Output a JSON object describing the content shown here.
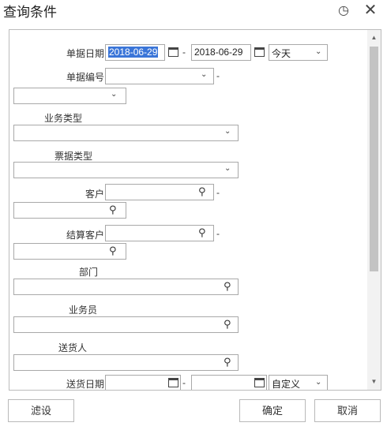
{
  "dialog": {
    "title": "查询条件",
    "help_icon": "?",
    "close_icon": "✕"
  },
  "form": {
    "doc_date": {
      "label": "单据日期",
      "from": "2018-06-29",
      "to": "2018-06-29",
      "period": "今天"
    },
    "doc_no": {
      "label": "单据编号",
      "value": "",
      "value2": ""
    },
    "biz_type": {
      "label": "业务类型",
      "value": ""
    },
    "bill_type": {
      "label": "票据类型",
      "value": ""
    },
    "customer": {
      "label": "客户",
      "from": "",
      "to": ""
    },
    "settle_customer": {
      "label": "结算客户",
      "from": "",
      "to": ""
    },
    "department": {
      "label": "部门",
      "value": ""
    },
    "salesman": {
      "label": "业务员",
      "value": ""
    },
    "deliverer": {
      "label": "送货人",
      "value": ""
    },
    "delivery_date": {
      "label": "送货日期",
      "from": "",
      "to": "",
      "period": "自定义"
    }
  },
  "separator": "-",
  "footer": {
    "filter_label": "滤设",
    "ok_label": "确定",
    "cancel_label": "取消"
  },
  "colors": {
    "selection": "#3a75d8",
    "border": "#a9a9a9",
    "scroll_thumb": "#c3c3c3"
  }
}
